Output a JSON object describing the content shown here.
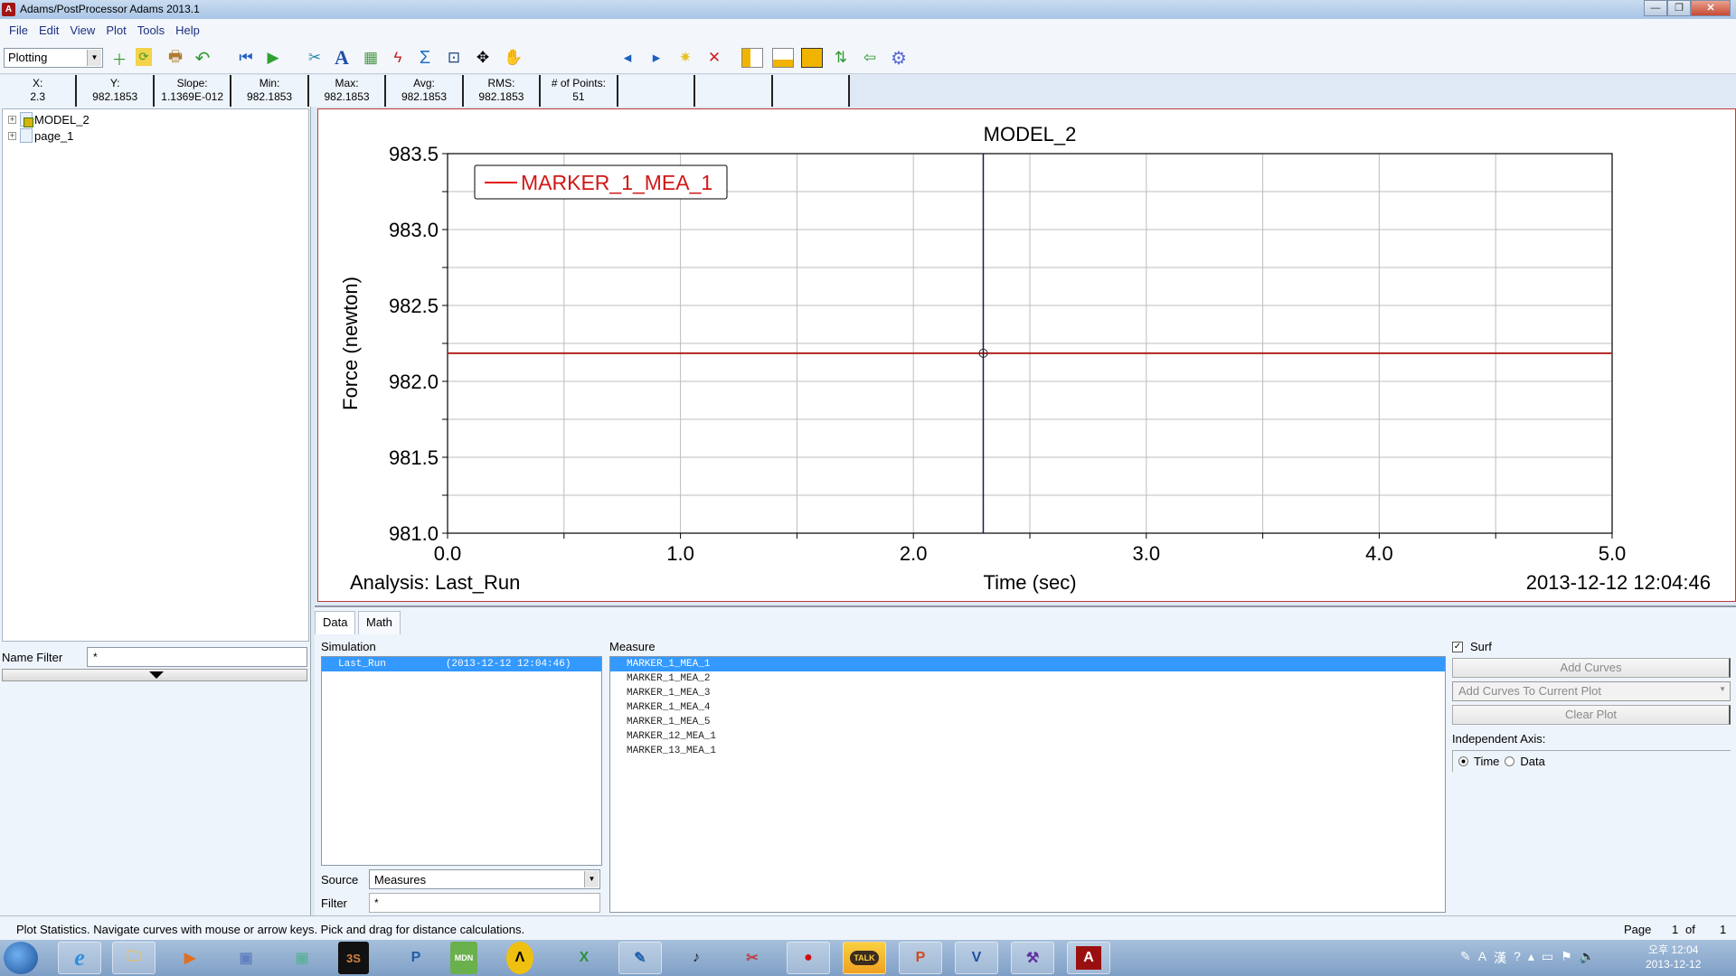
{
  "window": {
    "title": "Adams/PostProcessor Adams 2013.1",
    "app_icon_letter": "A",
    "min": "—",
    "restore": "❐",
    "close": "✕"
  },
  "menu": [
    "File",
    "Edit",
    "View",
    "Plot",
    "Tools",
    "Help"
  ],
  "toolbar": {
    "mode": "Plotting",
    "icons": [
      "new-page-icon",
      "refresh-icon",
      "print-icon",
      "undo-icon",
      "rewind-icon",
      "play-icon",
      "tools-icon",
      "text-icon",
      "table-icon",
      "curve-edit-icon",
      "math-sum-icon",
      "zoom-box-icon",
      "fit-icon",
      "pan-hand-icon",
      "prev-page-icon",
      "next-page-icon",
      "new-page-star-icon",
      "delete-page-icon",
      "layout-left-icon",
      "layout-bottom-icon",
      "layout-full-icon",
      "swap-icon",
      "back-arrow-icon",
      "settings-gear-icon"
    ]
  },
  "stats": [
    {
      "label": "X:",
      "value": "2.3"
    },
    {
      "label": "Y:",
      "value": "982.1853"
    },
    {
      "label": "Slope:",
      "value": "1.1369E-012"
    },
    {
      "label": "Min:",
      "value": "982.1853"
    },
    {
      "label": "Max:",
      "value": "982.1853"
    },
    {
      "label": "Avg:",
      "value": "982.1853"
    },
    {
      "label": "RMS:",
      "value": "982.1853"
    },
    {
      "label": "# of Points:",
      "value": "51"
    }
  ],
  "tree": [
    {
      "label": "MODEL_2",
      "icon": "model-icon"
    },
    {
      "label": "page_1",
      "icon": "page-icon"
    }
  ],
  "name_filter": {
    "label": "Name Filter",
    "value": "*"
  },
  "chart_data": {
    "type": "line",
    "title": "MODEL_2",
    "xlabel": "Time (sec)",
    "ylabel": "Force (newton)",
    "xlim": [
      0.0,
      5.0
    ],
    "ylim": [
      981.0,
      983.5
    ],
    "xticks": [
      "0.0",
      "1.0",
      "2.0",
      "3.0",
      "4.0",
      "5.0"
    ],
    "yticks": [
      "981.0",
      "981.5",
      "982.0",
      "982.5",
      "983.0",
      "983.5"
    ],
    "x_tick_values": [
      0,
      1,
      2,
      3,
      4,
      5
    ],
    "y_tick_values": [
      981.0,
      981.5,
      982.0,
      982.5,
      983.0,
      983.5
    ],
    "grid": true,
    "legend_position": "top-left",
    "series": [
      {
        "name": "MARKER_1_MEA_1",
        "color": "#b22222",
        "x": [
          0.0,
          5.0
        ],
        "y": [
          982.1853,
          982.1853
        ],
        "points": 51
      }
    ],
    "cursor": {
      "x": 2.3,
      "y": 982.1853
    },
    "footer_left": "Analysis:  Last_Run",
    "footer_right": "2013-12-12 12:04:46"
  },
  "bottom": {
    "tabs": [
      "Data",
      "Math"
    ],
    "simulation_label": "Simulation",
    "simulations": [
      {
        "name": "Last_Run",
        "time": "(2013-12-12 12:04:46)",
        "selected": true
      }
    ],
    "measure_label": "Measure",
    "measures": [
      "MARKER_1_MEA_1",
      "MARKER_1_MEA_2",
      "MARKER_1_MEA_3",
      "MARKER_1_MEA_4",
      "MARKER_1_MEA_5",
      "MARKER_12_MEA_1",
      "MARKER_13_MEA_1"
    ],
    "selected_measure": 0,
    "source_label": "Source",
    "source_value": "Measures",
    "filter_label": "Filter",
    "filter_value": "*",
    "surf_label": "Surf",
    "surf_checked": true,
    "add_curves": "Add Curves",
    "add_mode": "Add Curves To Current Plot",
    "clear_plot": "Clear Plot",
    "independent_axis_label": "Independent Axis:",
    "axis_options": [
      "Time",
      "Data"
    ],
    "axis_selected": "Time"
  },
  "status": {
    "text": "Plot Statistics.  Navigate curves with mouse or arrow keys.  Pick and drag for distance calculations.",
    "page_label": "Page",
    "page": "1",
    "of": "of",
    "total": "1"
  },
  "taskbar": {
    "apps": [
      "internet-explorer",
      "file-explorer",
      "media-player",
      "app-window-1",
      "app-window-2",
      "solidworks",
      "p-app",
      "mdn-app",
      "norton-app",
      "excel",
      "handwriting-app",
      "music-app",
      "snipping-app",
      "recorder-app",
      "kakaotalk",
      "powerpoint",
      "visio",
      "tool-app",
      "adams"
    ],
    "talk_label": "TALK",
    "clock_time": "오후 12:04",
    "clock_date": "2013-12-12"
  }
}
